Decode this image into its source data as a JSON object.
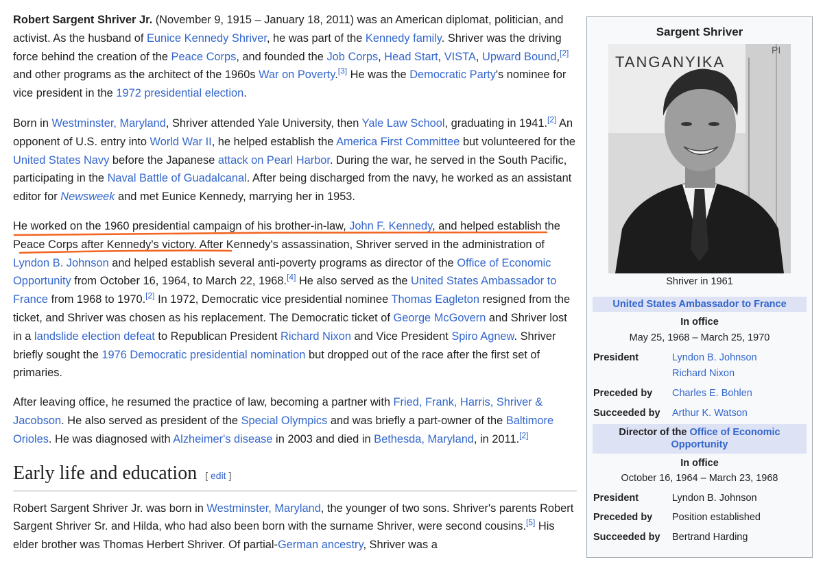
{
  "article": {
    "intro": {
      "subject": "Robert Sargent Shriver Jr.",
      "t1": " (November 9, 1915 – January 18, 2011) was an American diplomat, politician, and activist. As the husband of ",
      "l_eunice": "Eunice Kennedy Shriver",
      "t2": ", he was part of the ",
      "l_family": "Kennedy family",
      "t3": ". Shriver was the driving force behind the creation of the ",
      "l_peace": "Peace Corps",
      "t4": ", and founded the ",
      "l_job": "Job Corps",
      "c1": ", ",
      "l_head": "Head Start",
      "c2": ", ",
      "l_vista": "VISTA",
      "c3": ", ",
      "l_upward": "Upward Bound",
      "c4": ",",
      "r1": "[2]",
      "t5": " and other programs as the architect of the 1960s ",
      "l_poverty": "War on Poverty",
      "t6": ".",
      "r2": "[3]",
      "t7": " He was the ",
      "l_dem": "Democratic Party",
      "t8": "'s nominee for vice president in the ",
      "l_1972": "1972 presidential election",
      "t9": "."
    },
    "p2": {
      "t1": "Born in ",
      "l_west": "Westminster, Maryland",
      "t2": ", Shriver attended Yale University, then ",
      "l_yale": "Yale Law School",
      "t3": ", graduating in 1941.",
      "r1": "[2]",
      "t4": " An opponent of U.S. entry into ",
      "l_ww2": "World War II",
      "t5": ", he helped establish the ",
      "l_afc": "America First Committee",
      "t6": " but volunteered for the ",
      "l_navy": "United States Navy",
      "t7": " before the Japanese ",
      "l_pearl": "attack on Pearl Harbor",
      "t8": ". During the war, he served in the South Pacific, participating in the ",
      "l_guad": "Naval Battle of Guadalcanal",
      "t9": ". After being discharged from the navy, he worked as an assistant editor for ",
      "l_news": "Newsweek",
      "t10": " and met Eunice Kennedy, marrying her in 1953."
    },
    "p3": {
      "t1": "He worked on the 1960 presidential campaign of his brother-in-law, ",
      "l_jfk": "John F. Kennedy",
      "t2": ", and helped establish the Peace Corps after Kennedy's victory. After Kennedy's assassination, Shriver served in the administration of ",
      "l_lbj": "Lyndon B. Johnson",
      "t3": " and helped establish several anti-poverty programs as director of the ",
      "l_oeo": "Office of Economic Opportunity",
      "t4": " from October 16, 1964, to March 22, 1968.",
      "r1": "[4]",
      "t5": " He also served as the ",
      "l_amb": "United States Ambassador to France",
      "t6": " from 1968 to 1970.",
      "r2": "[2]",
      "t7": " In 1972, Democratic vice presidential nominee ",
      "l_eag": "Thomas Eagleton",
      "t8": " resigned from the ticket, and Shriver was chosen as his replacement. The Democratic ticket of ",
      "l_mcg": "George McGovern",
      "t9": " and Shriver lost in a ",
      "l_land": "landslide election defeat",
      "t10": " to Republican President ",
      "l_nixon": "Richard Nixon",
      "t11": " and Vice President ",
      "l_agnew": "Spiro Agnew",
      "t12": ". Shriver briefly sought the ",
      "l_1976": "1976 Democratic presidential nomination",
      "t13": " but dropped out of the race after the first set of primaries."
    },
    "p4": {
      "t1": "After leaving office, he resumed the practice of law, becoming a partner with ",
      "l_fried": "Fried, Frank, Harris, Shriver & Jacobson",
      "t2": ". He also served as president of the ",
      "l_so": "Special Olympics",
      "t3": " and was briefly a part-owner of the ",
      "l_bal": "Baltimore Orioles",
      "t4": ". He was diagnosed with ",
      "l_alz": "Alzheimer's disease",
      "t5": " in 2003 and died in ",
      "l_beth": "Bethesda, Maryland",
      "t6": ", in 2011.",
      "r1": "[2]"
    },
    "section": {
      "title": "Early life and education",
      "edit_open": "[ ",
      "edit_label": "edit",
      "edit_close": " ]"
    },
    "p5": {
      "t1": "Robert Sargent Shriver Jr. was born in ",
      "l_west": "Westminster, Maryland",
      "t2": ", the younger of two sons. Shriver's parents Robert Sargent Shriver Sr. and Hilda, who had also been born with the surname Shriver, were second cousins.",
      "r1": "[5]",
      "t3": " His elder brother was Thomas Herbert Shriver. Of partial-",
      "l_german": "German ancestry",
      "t4": ", Shriver was a"
    },
    "highlight_color": "#f26522"
  },
  "infobox": {
    "title": "Sargent Shriver",
    "photo_sign_text": "TANGANYIKA",
    "photo_sign_text2": "PI",
    "caption": "Shriver in 1961",
    "office1": {
      "title": "United States Ambassador to France",
      "in_office": "In office",
      "dates": "May 25, 1968 – March 25, 1970",
      "president_label": "President",
      "president1": "Lyndon B. Johnson",
      "president2": "Richard Nixon",
      "preceded_label": "Preceded by",
      "preceded": "Charles E. Bohlen",
      "succeeded_label": "Succeeded by",
      "succeeded": "Arthur K. Watson"
    },
    "office2": {
      "title_prefix": "Director of the ",
      "title_link": "Office of Economic Opportunity",
      "in_office": "In office",
      "dates": "October 16, 1964 – March 23, 1968",
      "president_label": "President",
      "president": "Lyndon B. Johnson",
      "preceded_label": "Preceded by",
      "preceded": "Position established",
      "succeeded_label": "Succeeded by",
      "succeeded": "Bertrand Harding"
    }
  }
}
